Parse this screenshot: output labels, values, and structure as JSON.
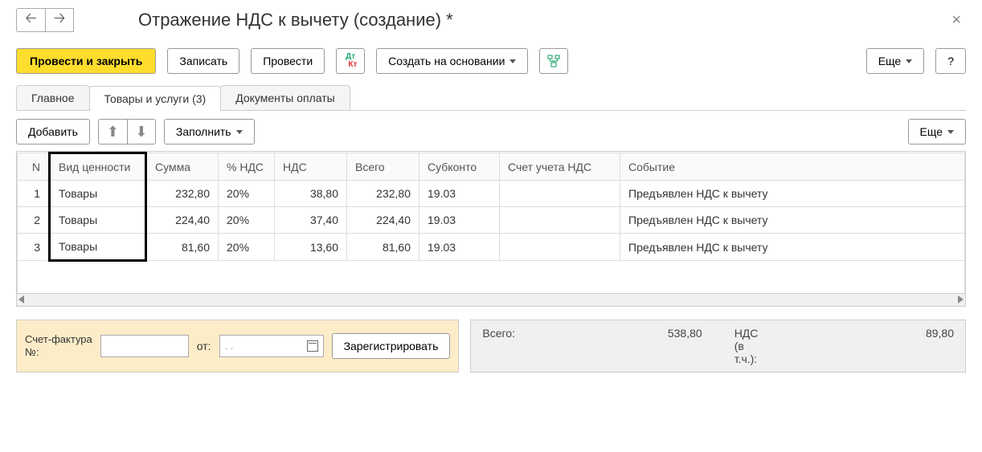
{
  "header": {
    "title": "Отражение НДС к вычету (создание) *"
  },
  "toolbar": {
    "primary": "Провести и закрыть",
    "save": "Записать",
    "post": "Провести",
    "create_based": "Создать на основании",
    "more": "Еще",
    "help": "?"
  },
  "tabs": {
    "main": "Главное",
    "goods": "Товары и услуги (3)",
    "payments": "Документы оплаты"
  },
  "subtoolbar": {
    "add": "Добавить",
    "fill": "Заполнить",
    "more": "Еще"
  },
  "table": {
    "headers": {
      "n": "N",
      "type": "Вид ценности",
      "sum": "Сумма",
      "pct": "% НДС",
      "vat": "НДС",
      "total": "Всего",
      "sub": "Субконто",
      "acct": "Счет учета НДС",
      "event": "Событие"
    },
    "rows": [
      {
        "n": "1",
        "type": "Товары",
        "sum": "232,80",
        "pct": "20%",
        "vat": "38,80",
        "total": "232,80",
        "sub": "19.03",
        "acct": "",
        "event": "Предъявлен НДС к вычету"
      },
      {
        "n": "2",
        "type": "Товары",
        "sum": "224,40",
        "pct": "20%",
        "vat": "37,40",
        "total": "224,40",
        "sub": "19.03",
        "acct": "",
        "event": "Предъявлен НДС к вычету"
      },
      {
        "n": "3",
        "type": "Товары",
        "sum": "81,60",
        "pct": "20%",
        "vat": "13,60",
        "total": "81,60",
        "sub": "19.03",
        "acct": "",
        "event": "Предъявлен НДС к вычету"
      }
    ]
  },
  "footer": {
    "invoice_label": "Счет-фактура\n№:",
    "from_label": "от:",
    "date_placeholder": ".   .",
    "register": "Зарегистрировать",
    "total_label": "Всего:",
    "total_value": "538,80",
    "vat_label": "НДС\n(в\nт.ч.):",
    "vat_value": "89,80"
  }
}
